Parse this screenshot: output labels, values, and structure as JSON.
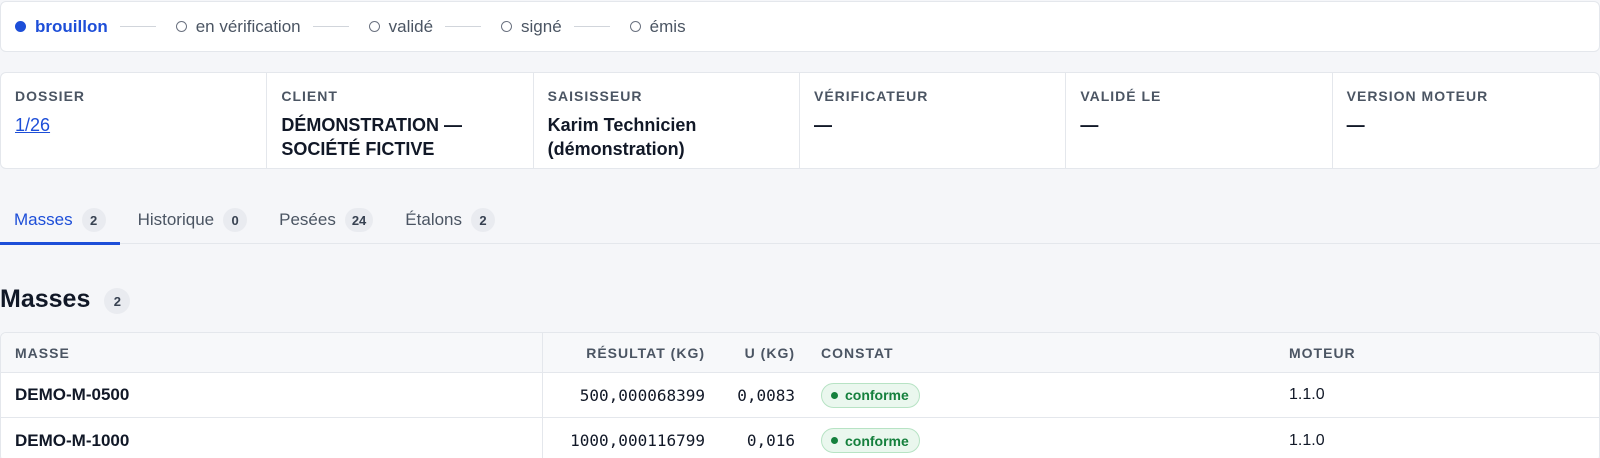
{
  "stepper": {
    "steps": [
      {
        "label": "brouillon",
        "active": true
      },
      {
        "label": "en vérification",
        "active": false
      },
      {
        "label": "validé",
        "active": false
      },
      {
        "label": "signé",
        "active": false
      },
      {
        "label": "émis",
        "active": false
      }
    ]
  },
  "meta": {
    "dossier": {
      "label": "DOSSIER",
      "value": "1/26"
    },
    "client": {
      "label": "CLIENT",
      "value_line1": "DÉMONSTRATION —",
      "value_line2": "SOCIÉTÉ FICTIVE"
    },
    "saisisseur": {
      "label": "SAISISSEUR",
      "value_line1": "Karim Technicien",
      "value_line2": "(démonstration)"
    },
    "verificateur": {
      "label": "VÉRIFICATEUR",
      "value": "—"
    },
    "valide_le": {
      "label": "VALIDÉ LE",
      "value": "—"
    },
    "version_moteur": {
      "label": "VERSION MOTEUR",
      "value": "—"
    }
  },
  "tabs": [
    {
      "label": "Masses",
      "count": "2",
      "active": true
    },
    {
      "label": "Historique",
      "count": "0",
      "active": false
    },
    {
      "label": "Pesées",
      "count": "24",
      "active": false
    },
    {
      "label": "Étalons",
      "count": "2",
      "active": false
    }
  ],
  "section": {
    "title": "Masses",
    "count": "2"
  },
  "table": {
    "headers": {
      "masse": "MASSE",
      "resultat": "RÉSULTAT (KG)",
      "u": "U (KG)",
      "constat": "CONSTAT",
      "moteur": "MOTEUR"
    },
    "rows": [
      {
        "masse": "DEMO-M-0500",
        "resultat": "500,000068399",
        "u": "0,0083",
        "constat": "conforme",
        "moteur": "1.1.0"
      },
      {
        "masse": "DEMO-M-1000",
        "resultat": "1000,000116799",
        "u": "0,016",
        "constat": "conforme",
        "moteur": "1.1.0"
      }
    ]
  },
  "colors": {
    "accent": "#1d4ed8",
    "success": "#15803d"
  }
}
